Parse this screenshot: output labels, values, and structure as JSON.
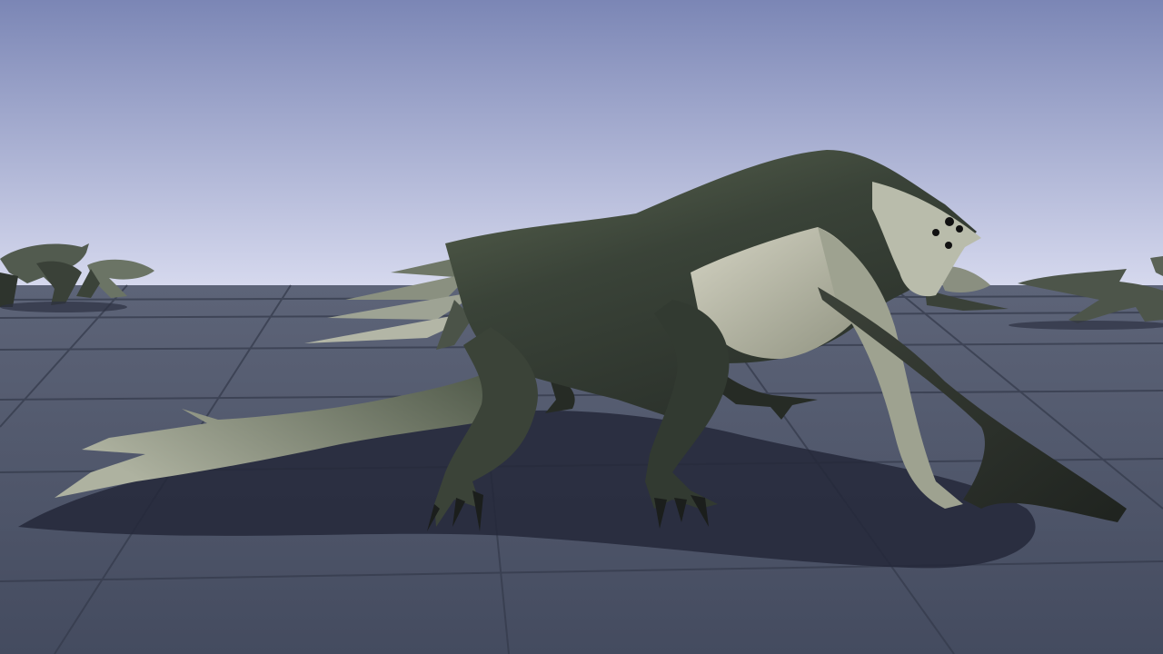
{
  "scene": {
    "kind": "3d-game-viewport",
    "hud_text": [],
    "sky_colors": {
      "top": "#7b86b5",
      "horizon": "#d6d9ee"
    },
    "ground_colors": {
      "near": "#444b5f",
      "far": "#5d6478",
      "tile_line": "#353b4c"
    },
    "creature_colors": {
      "skin_dark": "#2f372f",
      "skin_mid": "#5b6651",
      "skin_light": "#a9ad98",
      "belly": "#c9c8b7",
      "eye": "#111111",
      "claw": "#1b1e1c"
    },
    "shadow_color": "#24283a"
  }
}
